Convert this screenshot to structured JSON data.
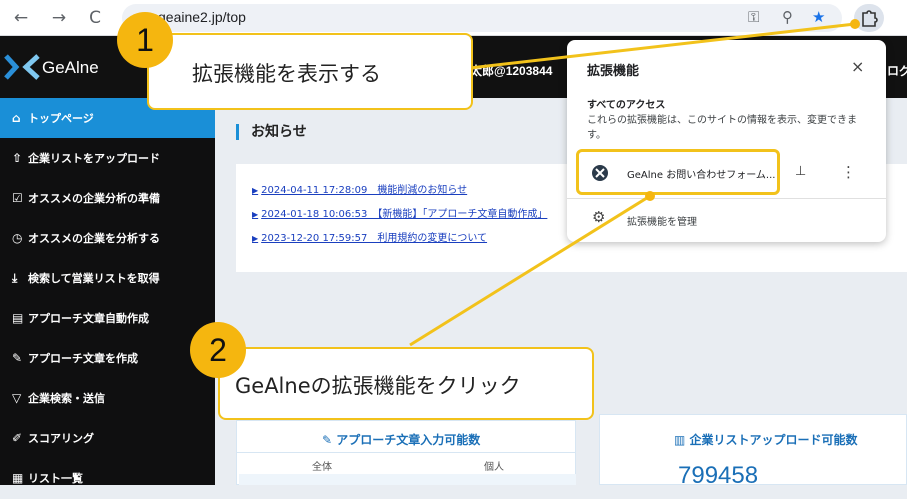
{
  "browser": {
    "url": "geaine2.jp/top",
    "back_label": "←",
    "forward_label": "→",
    "reload_label": "C"
  },
  "header": {
    "logo_text": "GeAlne",
    "user_text": "太郎@1203844",
    "logout_text": "ログ"
  },
  "sidebar": {
    "items": [
      {
        "icon": "⌂",
        "label": "トップページ"
      },
      {
        "icon": "⇧",
        "label": "企業リストをアップロード"
      },
      {
        "icon": "☑",
        "label": "オススメの企業分析の準備"
      },
      {
        "icon": "◷",
        "label": "オススメの企業を分析する"
      },
      {
        "icon": "⤓",
        "label": "検索して営業リストを取得"
      },
      {
        "icon": "▤",
        "label": "アプローチ文章自動作成"
      },
      {
        "icon": "✎",
        "label": "アプローチ文章を作成"
      },
      {
        "icon": "▽",
        "label": "企業検索・送信"
      },
      {
        "icon": "✐",
        "label": "スコアリング"
      },
      {
        "icon": "▦",
        "label": "リスト一覧"
      }
    ]
  },
  "notices": {
    "title": "お知らせ",
    "links": [
      "2024-04-11 17:28:09　機能削減のお知らせ",
      "2024-01-18 10:06:53　【新機能】「アプローチ文章自動作成」",
      "2023-12-20 17:59:57　利用規約の変更について"
    ]
  },
  "cards": {
    "approach": {
      "title": "アプローチ文章入力可能数",
      "col_all": "全体",
      "col_individual": "個人"
    },
    "upload": {
      "title": "企業リストアップロード可能数",
      "value": "799458"
    }
  },
  "extension_popup": {
    "title": "拡張機能",
    "close_label": "×",
    "access_heading": "すべてのアクセス",
    "access_desc": "これらの拡張機能は、このサイトの情報を表示、変更できます。",
    "extension_name": "GeAlne お問い合わせフォーム...",
    "manage_label": "拡張機能を管理"
  },
  "callouts": [
    {
      "number": "1",
      "text": "拡張機能を表示する"
    },
    {
      "number": "2",
      "text": "GeAlneの拡張機能をクリック"
    }
  ],
  "colors": {
    "accent": "#1a8fd7",
    "highlight": "#f2c21b",
    "badge": "#f5b60f"
  }
}
